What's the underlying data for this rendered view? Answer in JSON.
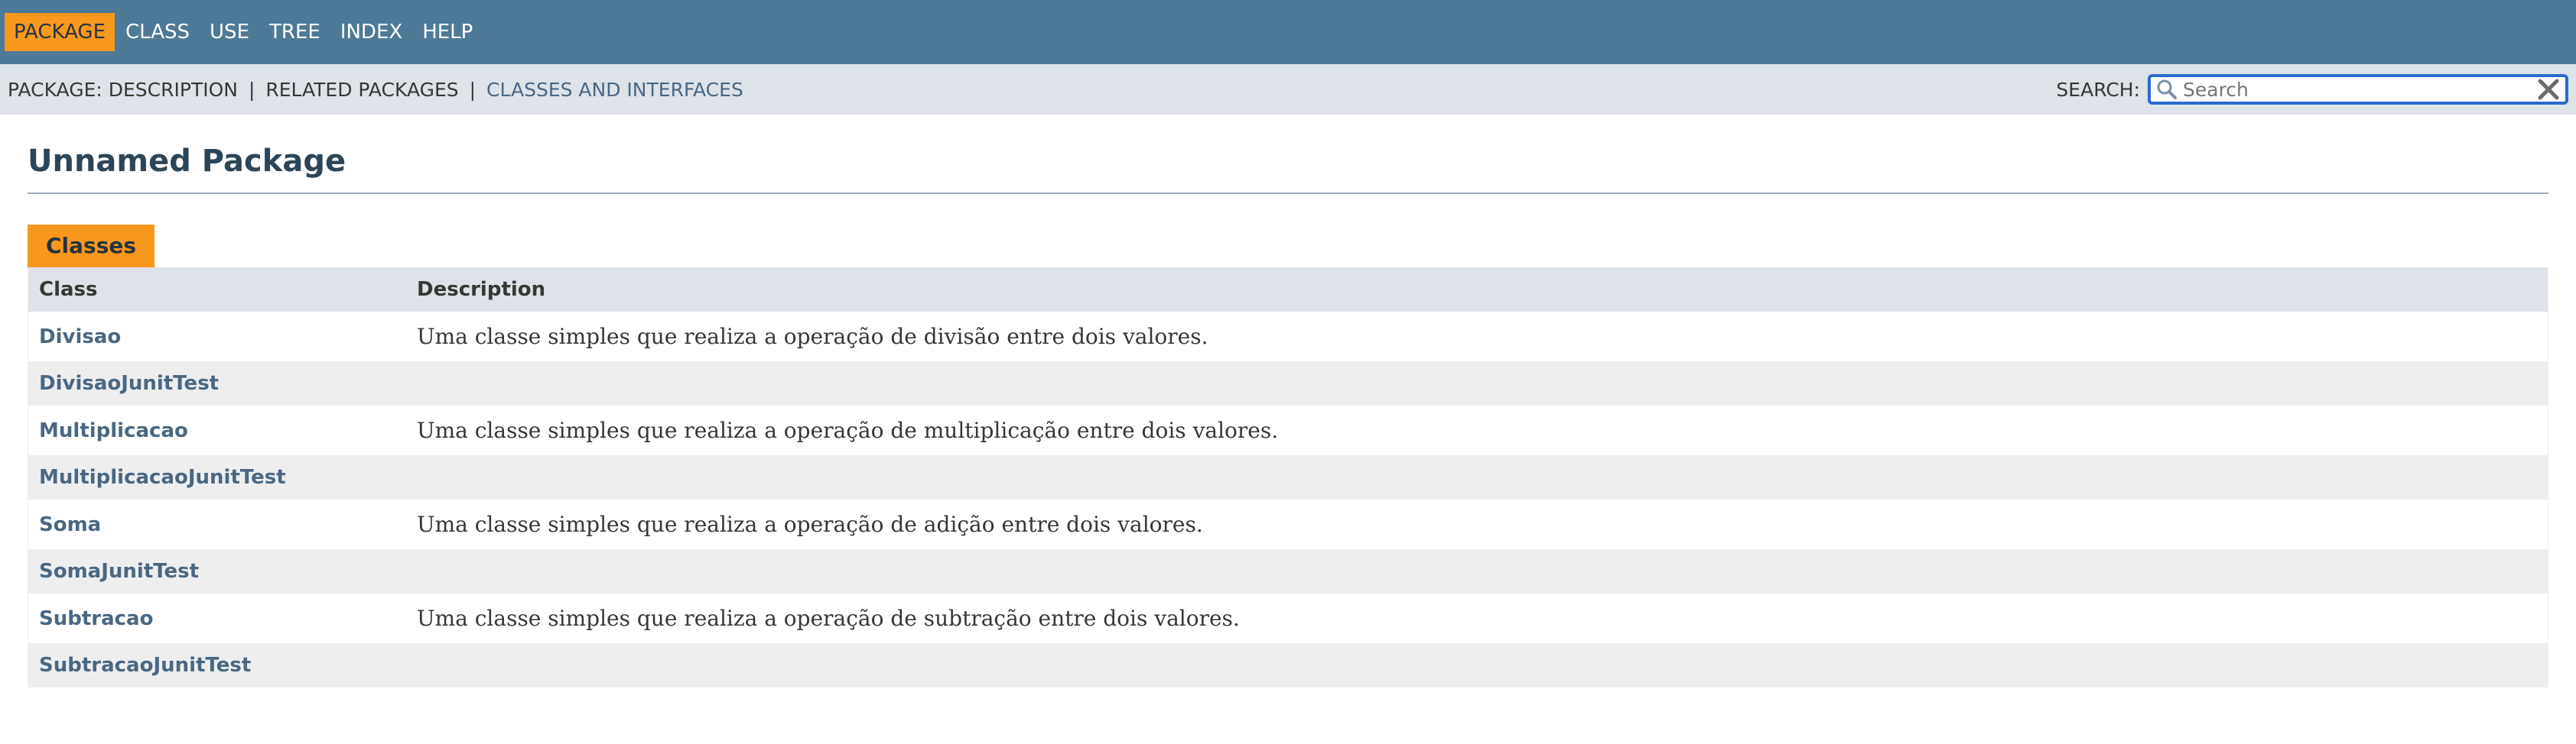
{
  "top_nav": {
    "items": [
      {
        "label": "PACKAGE",
        "active": true
      },
      {
        "label": "CLASS",
        "active": false
      },
      {
        "label": "USE",
        "active": false
      },
      {
        "label": "TREE",
        "active": false
      },
      {
        "label": "INDEX",
        "active": false
      },
      {
        "label": "HELP",
        "active": false
      }
    ]
  },
  "sub_nav": {
    "prefix": "PACKAGE:",
    "description": "DESCRIPTION",
    "related": "RELATED PACKAGES",
    "classes_link": "CLASSES AND INTERFACES",
    "separator": "|",
    "search_label": "SEARCH:",
    "search_placeholder": "Search",
    "search_value": ""
  },
  "main": {
    "title": "Unnamed Package",
    "caption": "Classes",
    "columns": [
      "Class",
      "Description"
    ],
    "rows": [
      {
        "name": "Divisao",
        "description": "Uma classe simples que realiza a operação de divisão entre dois valores."
      },
      {
        "name": "DivisaoJunitTest",
        "description": ""
      },
      {
        "name": "Multiplicacao",
        "description": "Uma classe simples que realiza a operação de multiplicação entre dois valores."
      },
      {
        "name": "MultiplicacaoJunitTest",
        "description": ""
      },
      {
        "name": "Soma",
        "description": "Uma classe simples que realiza a operação de adição entre dois valores."
      },
      {
        "name": "SomaJunitTest",
        "description": ""
      },
      {
        "name": "Subtracao",
        "description": "Uma classe simples que realiza a operação de subtração entre dois valores."
      },
      {
        "name": "SubtracaoJunitTest",
        "description": ""
      }
    ]
  },
  "colors": {
    "nav_bg": "#4d7a97",
    "subnav_bg": "#dee3e9",
    "accent": "#f8981d",
    "link": "#4a6782",
    "title": "#2c4557"
  },
  "icons": {
    "search": "search-icon",
    "clear": "close-icon"
  }
}
